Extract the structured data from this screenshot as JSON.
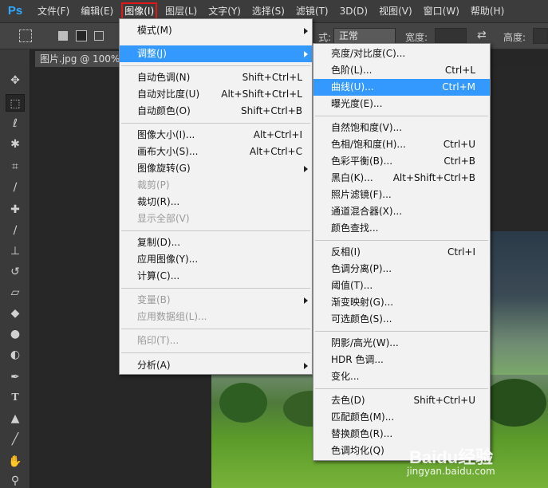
{
  "app": {
    "logo": "Ps"
  },
  "menubar": {
    "items": [
      {
        "label": "文件(F)"
      },
      {
        "label": "编辑(E)"
      },
      {
        "label": "图像(I)"
      },
      {
        "label": "图层(L)"
      },
      {
        "label": "文字(Y)"
      },
      {
        "label": "选择(S)"
      },
      {
        "label": "滤镜(T)"
      },
      {
        "label": "3D(D)"
      },
      {
        "label": "视图(V)"
      },
      {
        "label": "窗口(W)"
      },
      {
        "label": "帮助(H)"
      }
    ],
    "active_index": 2,
    "active_outline_color": "#e01818"
  },
  "options": {
    "style_suffix": "式:",
    "style_value": "正常",
    "width_label": "宽度:",
    "height_label": "高度:"
  },
  "document": {
    "tab_title": "图片.jpg @ 100%("
  },
  "image_menu": {
    "items": [
      {
        "label": "模式(M)",
        "shortcut": "",
        "submenu": true,
        "disabled": false
      },
      {
        "label": "调整(J)",
        "shortcut": "",
        "submenu": true,
        "disabled": false,
        "highlighted": true
      },
      {
        "label": "自动色调(N)",
        "shortcut": "Shift+Ctrl+L"
      },
      {
        "label": "自动对比度(U)",
        "shortcut": "Alt+Shift+Ctrl+L"
      },
      {
        "label": "自动颜色(O)",
        "shortcut": "Shift+Ctrl+B"
      },
      {
        "label": "图像大小(I)...",
        "shortcut": "Alt+Ctrl+I"
      },
      {
        "label": "画布大小(S)...",
        "shortcut": "Alt+Ctrl+C"
      },
      {
        "label": "图像旋转(G)",
        "shortcut": "",
        "submenu": true
      },
      {
        "label": "裁剪(P)",
        "shortcut": "",
        "disabled": true
      },
      {
        "label": "裁切(R)...",
        "shortcut": ""
      },
      {
        "label": "显示全部(V)",
        "shortcut": "",
        "disabled": true
      },
      {
        "label": "复制(D)...",
        "shortcut": ""
      },
      {
        "label": "应用图像(Y)...",
        "shortcut": ""
      },
      {
        "label": "计算(C)...",
        "shortcut": ""
      },
      {
        "label": "变量(B)",
        "shortcut": "",
        "submenu": true,
        "disabled": true
      },
      {
        "label": "应用数据组(L)...",
        "shortcut": "",
        "disabled": true
      },
      {
        "label": "陷印(T)...",
        "shortcut": "",
        "disabled": true
      },
      {
        "label": "分析(A)",
        "shortcut": "",
        "submenu": true
      }
    ]
  },
  "adjust_menu": {
    "items": [
      {
        "label": "亮度/对比度(C)...",
        "shortcut": ""
      },
      {
        "label": "色阶(L)...",
        "shortcut": "Ctrl+L"
      },
      {
        "label": "曲线(U)...",
        "shortcut": "Ctrl+M",
        "highlighted": true
      },
      {
        "label": "曝光度(E)...",
        "shortcut": ""
      },
      {
        "label": "自然饱和度(V)...",
        "shortcut": ""
      },
      {
        "label": "色相/饱和度(H)...",
        "shortcut": "Ctrl+U"
      },
      {
        "label": "色彩平衡(B)...",
        "shortcut": "Ctrl+B"
      },
      {
        "label": "黑白(K)...",
        "shortcut": "Alt+Shift+Ctrl+B"
      },
      {
        "label": "照片滤镜(F)...",
        "shortcut": ""
      },
      {
        "label": "通道混合器(X)...",
        "shortcut": ""
      },
      {
        "label": "颜色查找...",
        "shortcut": ""
      },
      {
        "label": "反相(I)",
        "shortcut": "Ctrl+I"
      },
      {
        "label": "色调分离(P)...",
        "shortcut": ""
      },
      {
        "label": "阈值(T)...",
        "shortcut": ""
      },
      {
        "label": "渐变映射(G)...",
        "shortcut": ""
      },
      {
        "label": "可选颜色(S)...",
        "shortcut": ""
      },
      {
        "label": "阴影/高光(W)...",
        "shortcut": ""
      },
      {
        "label": "HDR 色调...",
        "shortcut": ""
      },
      {
        "label": "变化...",
        "shortcut": ""
      },
      {
        "label": "去色(D)",
        "shortcut": "Shift+Ctrl+U"
      },
      {
        "label": "匹配颜色(M)...",
        "shortcut": ""
      },
      {
        "label": "替换颜色(R)...",
        "shortcut": ""
      },
      {
        "label": "色调均化(Q)",
        "shortcut": ""
      }
    ]
  },
  "watermark": {
    "brand": "Baidu经验",
    "url": "jingyan.baidu.com"
  },
  "colors": {
    "highlight": "#3399ff",
    "menu_bg": "#f2f2f2",
    "chrome_dark": "#3c3c3c"
  }
}
